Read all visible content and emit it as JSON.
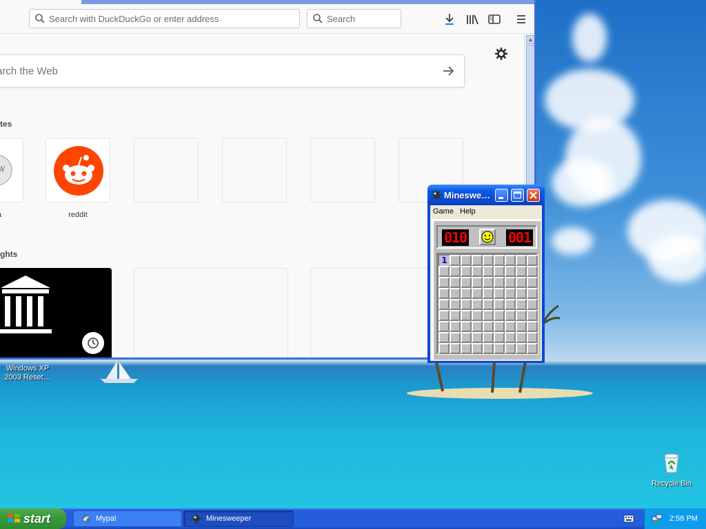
{
  "browser": {
    "url_placeholder": "Search with DuckDuckGo or enter address",
    "search_placeholder": "Search",
    "web_search_placeholder": "arch the Web",
    "top_sites_heading": "tes",
    "top_sites": [
      {
        "label": "a",
        "icon": "wikipedia-icon"
      },
      {
        "label": "reddit",
        "icon": "reddit-icon"
      }
    ],
    "highlights_heading": "ghts"
  },
  "desktop": {
    "icons": [
      {
        "label_line1": "Windows XP",
        "label_line2": "2003 Reset…",
        "icon": "shortcut-icon"
      },
      {
        "label": "Recycle Bin",
        "icon": "recycle-bin-icon"
      }
    ]
  },
  "minesweeper": {
    "title": "Mineswe…",
    "menu": [
      "Game",
      "Help"
    ],
    "mines_left": "010",
    "timer": "001",
    "rows": 9,
    "cols": 9,
    "revealed": [
      {
        "row": 0,
        "col": 0,
        "value": "1"
      }
    ]
  },
  "taskbar": {
    "start_label": "start",
    "tasks": [
      {
        "label": "Mypal",
        "active": false
      },
      {
        "label": "Minesweeper",
        "active": true
      }
    ],
    "clock": "2:58 PM"
  },
  "colors": {
    "xp_blue": "#245edc",
    "start_green": "#3a9a3d",
    "reddit_orange": "#ff4500",
    "led_red": "#ff0000"
  }
}
